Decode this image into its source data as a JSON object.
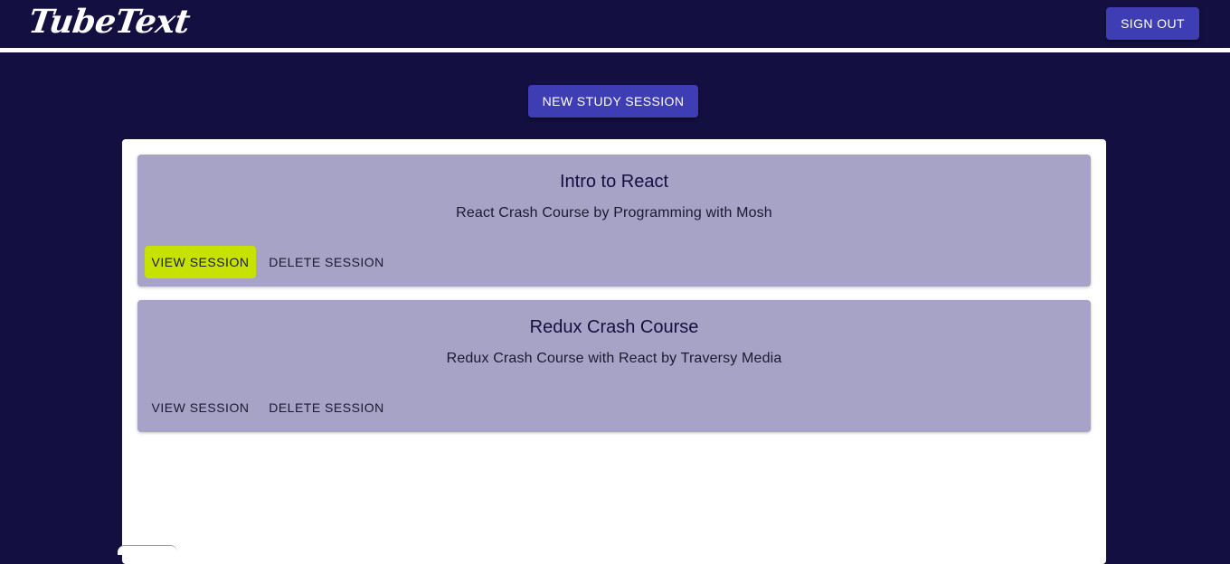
{
  "app": {
    "logo_text": "TubeText",
    "sign_out_label": "SIGN OUT"
  },
  "main": {
    "new_session_label": "NEW STUDY SESSION",
    "sessions": [
      {
        "title": "Intro to React",
        "subtitle": "React Crash Course by Programming with Mosh",
        "view_label": "VIEW SESSION",
        "delete_label": "DELETE SESSION",
        "view_highlighted": true
      },
      {
        "title": "Redux Crash Course",
        "subtitle": "Redux Crash Course with React by Traversy Media",
        "view_label": "VIEW SESSION",
        "delete_label": "DELETE SESSION",
        "view_highlighted": false
      }
    ]
  },
  "colors": {
    "background": "#130f40",
    "primary_button": "#3f3db4",
    "card": "#a6a3c7",
    "highlight": "#c6e200"
  }
}
